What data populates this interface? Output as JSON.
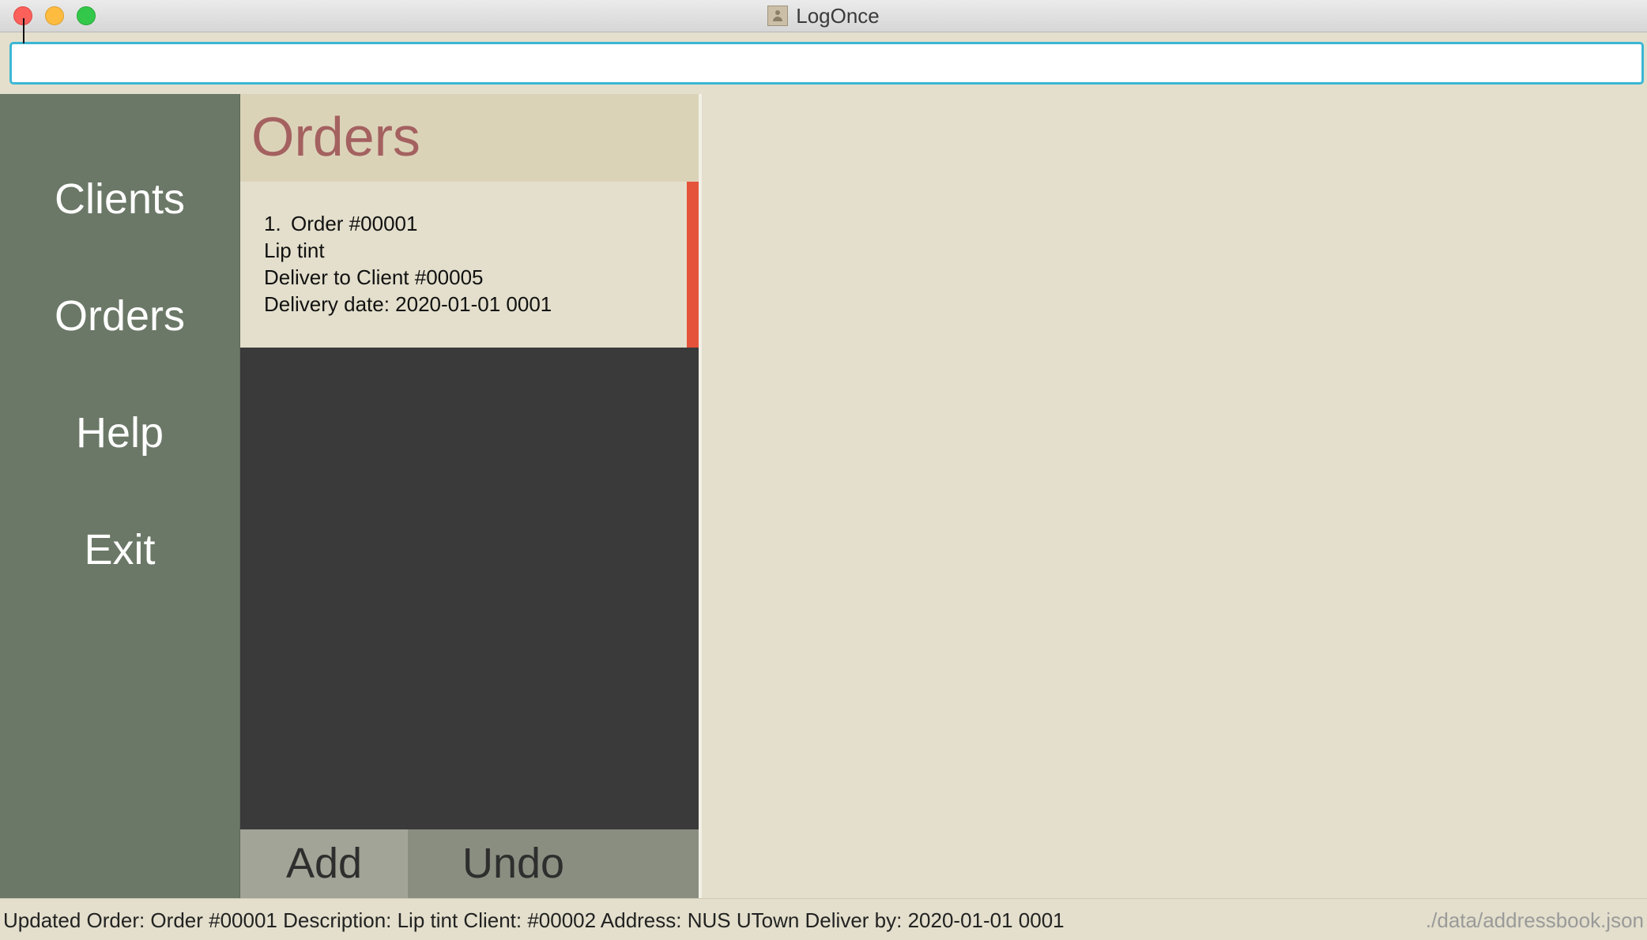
{
  "window": {
    "title": "LogOnce"
  },
  "command_box": {
    "value": "",
    "placeholder": ""
  },
  "sidebar": {
    "items": [
      {
        "label": "Clients"
      },
      {
        "label": "Orders"
      },
      {
        "label": "Help"
      },
      {
        "label": "Exit"
      }
    ]
  },
  "orders_panel": {
    "title": "Orders",
    "orders": [
      {
        "index": "1.",
        "id": "Order #00001",
        "description": "Lip tint",
        "client": "Deliver to Client #00005",
        "delivery_date": "Delivery date: 2020-01-01 0001",
        "status_color": "#e5533a"
      }
    ],
    "add_label": "Add",
    "undo_label": "Undo"
  },
  "status_bar": {
    "message": "Updated Order: Order #00001  Description: Lip tint Client: #00002 Address: NUS UTown Deliver by: 2020-01-01 0001",
    "save_path": "./data/addressbook.json"
  },
  "colors": {
    "sidebar": "#6b7867",
    "panel_header": "#dbd3b8",
    "title_accent": "#a46160",
    "background": "#e3dfcc",
    "list_background": "#3a3a3a",
    "input_focus": "#3bb7d4"
  }
}
